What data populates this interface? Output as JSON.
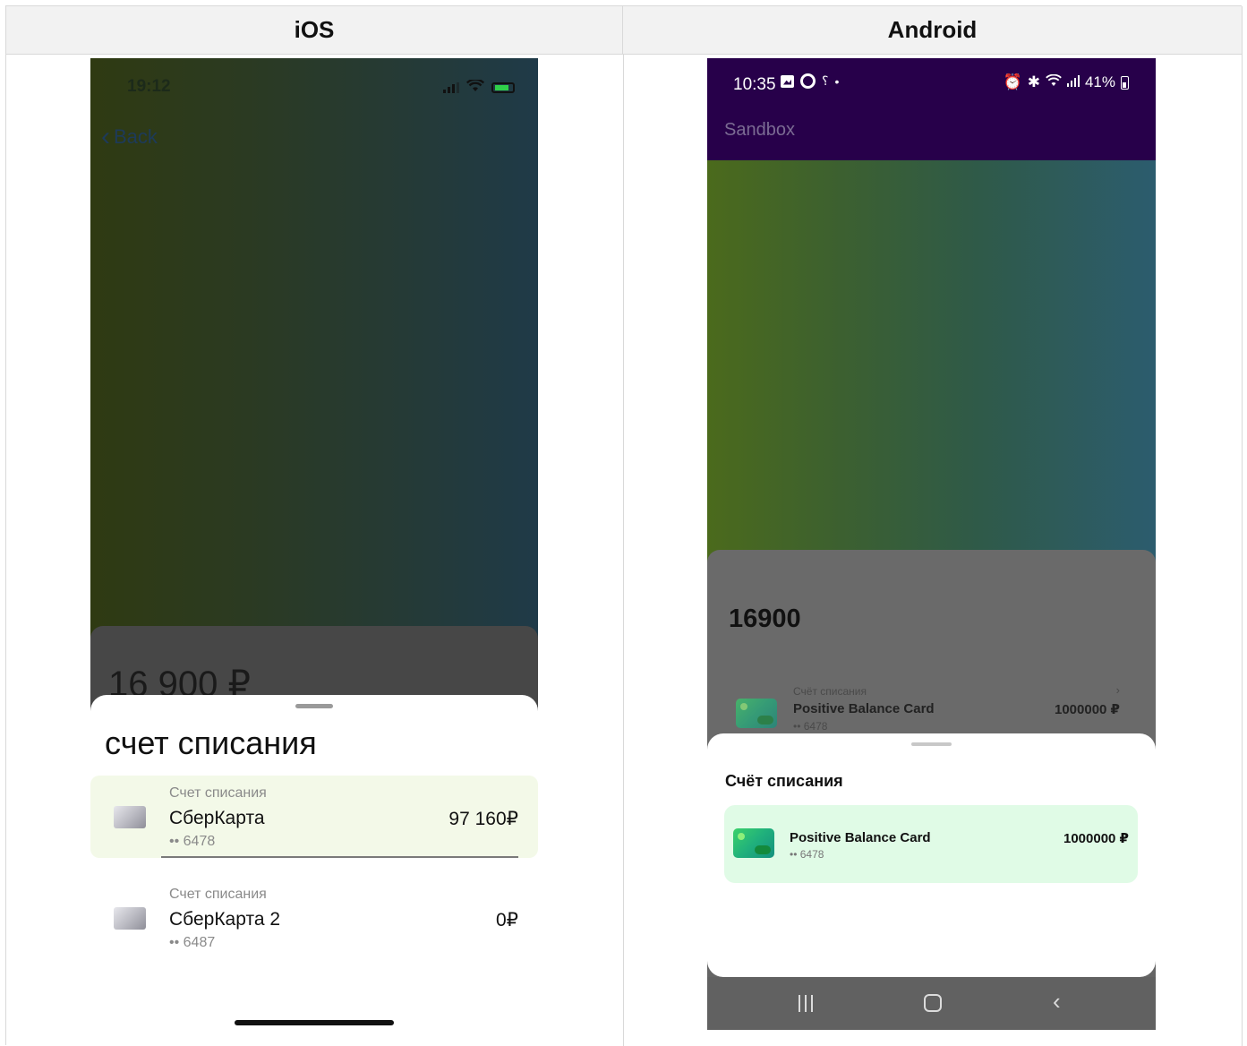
{
  "headers": {
    "ios": "iOS",
    "android": "Android"
  },
  "ios": {
    "status_time": "19:12",
    "back_label": "Back",
    "amount": "16 900 ₽",
    "sheet_title": "счет списания",
    "accounts": [
      {
        "label": "Счет списания",
        "name": "СберКарта",
        "number": "•• 6478",
        "amount": "97 160₽",
        "selected": true
      },
      {
        "label": "Счет списания",
        "name": "СберКарта 2",
        "number": "•• 6487",
        "amount": "0₽",
        "selected": false
      }
    ]
  },
  "android": {
    "status_time": "10:35",
    "battery": "41%",
    "app_title": "Sandbox",
    "amount": "16900",
    "behind": {
      "label": "Счёт списания",
      "name": "Positive Balance Card",
      "number": "•• 6478",
      "amount": "1000000 ₽",
      "chevron": "›"
    },
    "sheet_title": "Счёт списания",
    "account": {
      "name": "Positive Balance Card",
      "number": "•• 6478",
      "amount": "1000000 ₽"
    },
    "nav_back": "‹"
  },
  "colors": {
    "sheet_selected_ios": "#f3f9e8",
    "sheet_selected_android": "#e0fbe6",
    "android_appbar": "#27004a"
  }
}
